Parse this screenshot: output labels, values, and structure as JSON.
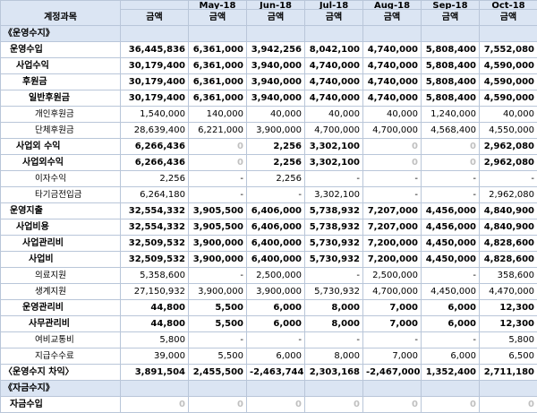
{
  "header": {
    "account_label": "계정과목",
    "months": [
      "",
      "May-18",
      "Jun-18",
      "Jul-18",
      "Aug-18",
      "Sep-18",
      "Oct-18"
    ],
    "amount_labels": [
      "금액",
      "금액",
      "금액",
      "금액",
      "금액",
      "금액",
      "금액"
    ]
  },
  "rows": [
    {
      "label": "《운영수지》",
      "indent": 0,
      "style": "section",
      "values": [
        "",
        "",
        "",
        "",
        "",
        "",
        ""
      ]
    },
    {
      "label": "운영수입",
      "indent": 1,
      "style": "bold",
      "values": [
        "36,445,836",
        "6,361,000",
        "3,942,256",
        "8,042,100",
        "4,740,000",
        "5,808,400",
        "7,552,080"
      ]
    },
    {
      "label": "사업수익",
      "indent": 2,
      "style": "bold",
      "values": [
        "30,179,400",
        "6,361,000",
        "3,940,000",
        "4,740,000",
        "4,740,000",
        "5,808,400",
        "4,590,000"
      ]
    },
    {
      "label": "후원금",
      "indent": 3,
      "style": "bold",
      "values": [
        "30,179,400",
        "6,361,000",
        "3,940,000",
        "4,740,000",
        "4,740,000",
        "5,808,400",
        "4,590,000"
      ]
    },
    {
      "label": "일반후원금",
      "indent": 4,
      "style": "bold",
      "values": [
        "30,179,400",
        "6,361,000",
        "3,940,000",
        "4,740,000",
        "4,740,000",
        "5,808,400",
        "4,590,000"
      ]
    },
    {
      "label": "개인후원금",
      "indent": 5,
      "style": "light",
      "values": [
        "1,540,000",
        "140,000",
        "40,000",
        "40,000",
        "40,000",
        "1,240,000",
        "40,000"
      ]
    },
    {
      "label": "단체후원금",
      "indent": 5,
      "style": "light",
      "values": [
        "28,639,400",
        "6,221,000",
        "3,900,000",
        "4,700,000",
        "4,700,000",
        "4,568,400",
        "4,550,000"
      ]
    },
    {
      "label": "사업외 수익",
      "indent": 2,
      "style": "bold",
      "values": [
        "6,266,436",
        "0",
        "2,256",
        "3,302,100",
        "0",
        "0",
        "2,962,080"
      ]
    },
    {
      "label": "사업외수익",
      "indent": 3,
      "style": "bold",
      "values": [
        "6,266,436",
        "0",
        "2,256",
        "3,302,100",
        "0",
        "0",
        "2,962,080"
      ]
    },
    {
      "label": "이자수익",
      "indent": 5,
      "style": "light",
      "values": [
        "2,256",
        "-",
        "2,256",
        "-",
        "-",
        "-",
        "-"
      ]
    },
    {
      "label": "타기금전입금",
      "indent": 5,
      "style": "light",
      "values": [
        "6,264,180",
        "-",
        "-",
        "3,302,100",
        "-",
        "-",
        "2,962,080"
      ]
    },
    {
      "label": "운영지출",
      "indent": 1,
      "style": "bold",
      "values": [
        "32,554,332",
        "3,905,500",
        "6,406,000",
        "5,738,932",
        "7,207,000",
        "4,456,000",
        "4,840,900"
      ]
    },
    {
      "label": "사업비용",
      "indent": 2,
      "style": "bold",
      "values": [
        "32,554,332",
        "3,905,500",
        "6,406,000",
        "5,738,932",
        "7,207,000",
        "4,456,000",
        "4,840,900"
      ]
    },
    {
      "label": "사업관리비",
      "indent": 3,
      "style": "bold",
      "values": [
        "32,509,532",
        "3,900,000",
        "6,400,000",
        "5,730,932",
        "7,200,000",
        "4,450,000",
        "4,828,600"
      ]
    },
    {
      "label": "사업비",
      "indent": 4,
      "style": "bold",
      "values": [
        "32,509,532",
        "3,900,000",
        "6,400,000",
        "5,730,932",
        "7,200,000",
        "4,450,000",
        "4,828,600"
      ]
    },
    {
      "label": "의료지원",
      "indent": 5,
      "style": "light",
      "values": [
        "5,358,600",
        "-",
        "2,500,000",
        "-",
        "2,500,000",
        "-",
        "358,600"
      ]
    },
    {
      "label": "생계지원",
      "indent": 5,
      "style": "light",
      "values": [
        "27,150,932",
        "3,900,000",
        "3,900,000",
        "5,730,932",
        "4,700,000",
        "4,450,000",
        "4,470,000"
      ]
    },
    {
      "label": "운영관리비",
      "indent": 3,
      "style": "bold",
      "values": [
        "44,800",
        "5,500",
        "6,000",
        "8,000",
        "7,000",
        "6,000",
        "12,300"
      ]
    },
    {
      "label": "사무관리비",
      "indent": 4,
      "style": "bold",
      "values": [
        "44,800",
        "5,500",
        "6,000",
        "8,000",
        "7,000",
        "6,000",
        "12,300"
      ]
    },
    {
      "label": "여비교통비",
      "indent": 5,
      "style": "light",
      "values": [
        "5,800",
        "-",
        "-",
        "-",
        "-",
        "-",
        "5,800"
      ]
    },
    {
      "label": "지급수수료",
      "indent": 5,
      "style": "light",
      "values": [
        "39,000",
        "5,500",
        "6,000",
        "8,000",
        "7,000",
        "6,000",
        "6,500"
      ]
    },
    {
      "label": "〈운영수지 차익〉",
      "indent": 0,
      "style": "bold",
      "values": [
        "3,891,504",
        "2,455,500",
        "-2,463,744",
        "2,303,168",
        "-2,467,000",
        "1,352,400",
        "2,711,180"
      ]
    },
    {
      "label": "《자금수지》",
      "indent": 0,
      "style": "section",
      "values": [
        "",
        "",
        "",
        "",
        "",
        "",
        ""
      ]
    },
    {
      "label": "자금수입",
      "indent": 1,
      "style": "bold",
      "values": [
        "0",
        "0",
        "0",
        "0",
        "0",
        "0",
        "0"
      ]
    }
  ]
}
